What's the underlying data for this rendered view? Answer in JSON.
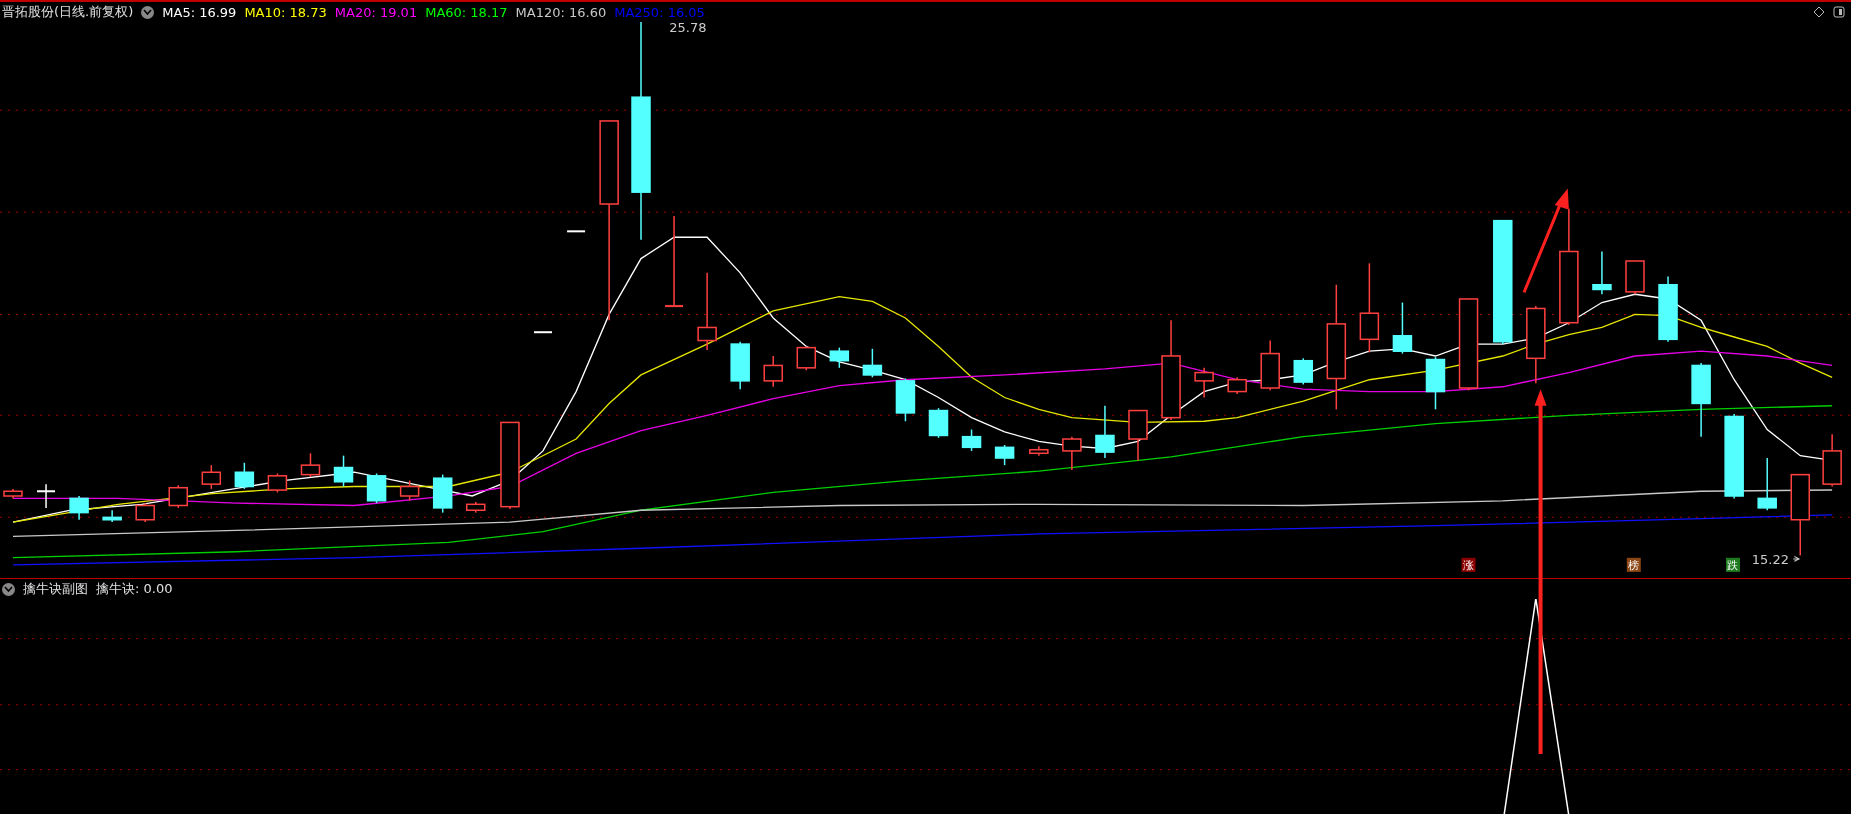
{
  "main_panel": {
    "title": "晋拓股份(日线.前复权)",
    "indicators": [
      {
        "text": "MA5: 16.99",
        "color": "#ffffff"
      },
      {
        "text": "MA10: 18.73",
        "color": "#ffff00"
      },
      {
        "text": "MA20: 19.01",
        "color": "#ff00ff"
      },
      {
        "text": "MA60: 18.17",
        "color": "#00ff00"
      },
      {
        "text": "MA120: 16.60",
        "color": "#c8c8c8"
      },
      {
        "text": "MA250: 16.05",
        "color": "#0000ff"
      }
    ],
    "high_label": "25.78",
    "low_label": "15.22",
    "tags": [
      {
        "text": "涨",
        "color": "#8b0000"
      },
      {
        "text": "榜",
        "color": "#8b4513"
      },
      {
        "text": "跌",
        "color": "#1e7a1e"
      }
    ]
  },
  "sub_panel": {
    "title": "擒牛诀副图",
    "indicator": "擒牛诀: 0.00"
  }
}
